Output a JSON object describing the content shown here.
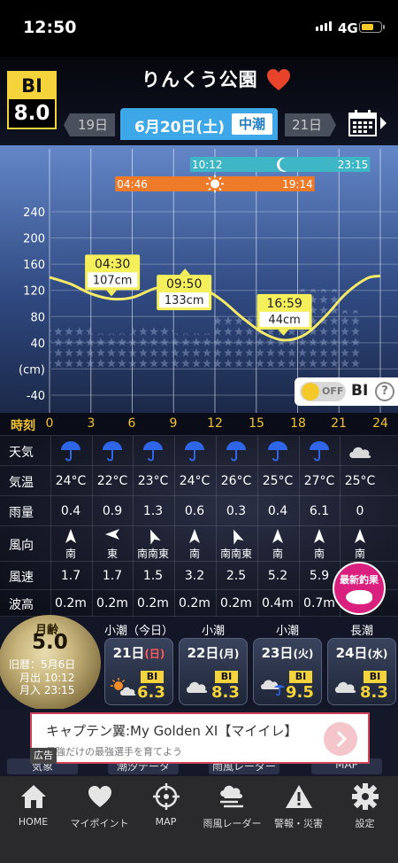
{
  "status": {
    "time": "12:50",
    "network": "4G"
  },
  "header": {
    "bi_label": "BI",
    "bi_value": "8.0",
    "place": "りんくう公園",
    "prev_day": "19日",
    "date": "6月20日(土)",
    "tide_type": "中潮",
    "next_day": "21日"
  },
  "chart_data": {
    "type": "line",
    "x_ticks": [
      0,
      3,
      6,
      9,
      12,
      15,
      18,
      21,
      24
    ],
    "y_ticks": [
      "240",
      "200",
      "160",
      "120",
      "80",
      "40",
      "(cm)",
      "-40"
    ],
    "xlim": [
      0,
      24
    ],
    "ylim": [
      -40,
      240
    ],
    "tide_curve": {
      "x": [
        0,
        1.5,
        3,
        4.5,
        6,
        7.5,
        9,
        9.83,
        11,
        12.5,
        14,
        15.5,
        17,
        18.5,
        20,
        21.5,
        23,
        24
      ],
      "y": [
        140,
        130,
        115,
        107,
        109,
        122,
        131,
        133,
        125,
        105,
        78,
        55,
        44,
        52,
        80,
        115,
        138,
        142
      ]
    },
    "annotations": [
      {
        "time": "04:30",
        "height": "107cm",
        "x": 4.5,
        "y": 107
      },
      {
        "time": "09:50",
        "height": "133cm",
        "x": 9.83,
        "y": 133
      },
      {
        "time": "16:59",
        "height": "44cm",
        "x": 16.98,
        "y": 44
      }
    ],
    "moon_bar": {
      "start": "10:12",
      "end": "23:15"
    },
    "sun_bar": {
      "start": "04:46",
      "end": "19:14"
    },
    "grid": true
  },
  "bi_toggle": {
    "state": "OFF",
    "label": "BI",
    "help": "?"
  },
  "time_row": {
    "label": "時刻",
    "ticks": [
      "0",
      "3",
      "6",
      "9",
      "12",
      "15",
      "18",
      "21",
      "24"
    ]
  },
  "weather": {
    "rows": [
      {
        "label": "天気",
        "key": "weather"
      },
      {
        "label": "気温",
        "key": "temp"
      },
      {
        "label": "雨量",
        "key": "rain"
      },
      {
        "label": "風向",
        "key": "wind_dir"
      },
      {
        "label": "風速",
        "key": "wind_speed"
      },
      {
        "label": "波高",
        "key": "wave"
      }
    ],
    "weather": [
      "rain",
      "rain",
      "rain",
      "rain",
      "rain",
      "rain",
      "rain",
      "cloud"
    ],
    "temp": [
      "24°C",
      "22°C",
      "23°C",
      "24°C",
      "26°C",
      "25°C",
      "27°C",
      "25°C"
    ],
    "rain": [
      "0.4",
      "0.9",
      "1.3",
      "0.6",
      "0.3",
      "0.4",
      "6.1",
      "0"
    ],
    "wind_dir": [
      "南",
      "東",
      "南南東",
      "南",
      "南南東",
      "南",
      "南",
      "南"
    ],
    "wind_speed": [
      "1.7",
      "1.7",
      "1.5",
      "3.2",
      "2.5",
      "5.2",
      "5.9",
      ""
    ],
    "wave": [
      "0.2m",
      "0.2m",
      "0.2m",
      "0.2m",
      "0.2m",
      "0.4m",
      "0.7m",
      ""
    ],
    "latest_button": "最新釣果"
  },
  "moon": {
    "label": "月齢",
    "age": "5.0",
    "lunar": "旧暦：5月6日",
    "moonrise": "月出 10:12",
    "moonset": "月入 23:15"
  },
  "forecast": [
    {
      "tide": "小潮（今日）",
      "date": "21日",
      "dow": "(日)",
      "bi": "6.3"
    },
    {
      "tide": "小潮",
      "date": "22日",
      "dow": "(月)",
      "bi": "8.3"
    },
    {
      "tide": "小潮",
      "date": "23日",
      "dow": "(火)",
      "bi": "9.5"
    },
    {
      "tide": "長潮",
      "date": "24日",
      "dow": "(水)",
      "bi": "8.3"
    }
  ],
  "ad": {
    "tag": "広告",
    "title": "キャプテン翼:My Golden XI【マイイレ】",
    "sub": "最強だけの最強選手を育てよう"
  },
  "menu_under": [
    "気象",
    "潮汐データ",
    "雨風レーダー",
    "MAP"
  ],
  "nav": [
    {
      "label": "HOME",
      "icon": "home-icon"
    },
    {
      "label": "マイポイント",
      "icon": "heart-icon"
    },
    {
      "label": "MAP",
      "icon": "crosshair-icon"
    },
    {
      "label": "雨風レーダー",
      "icon": "cloud-wind-icon"
    },
    {
      "label": "警報・災害",
      "icon": "warning-icon"
    },
    {
      "label": "設定",
      "icon": "gear-icon"
    }
  ]
}
